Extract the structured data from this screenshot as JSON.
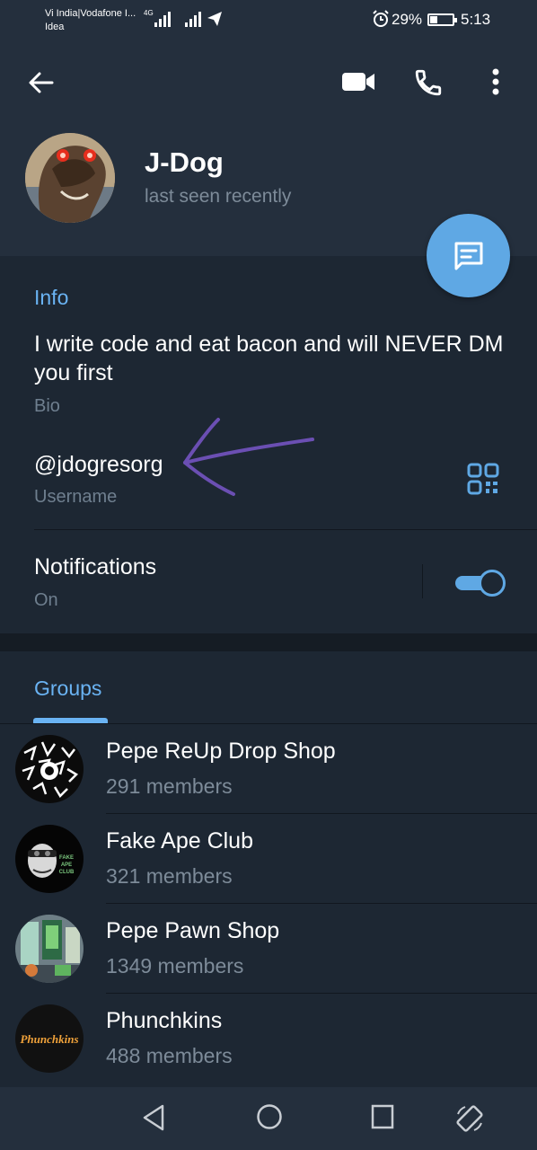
{
  "status_bar": {
    "carrier_line1": "Vi India|Vodafone I...",
    "carrier_line2": "Idea",
    "network_type": "4G",
    "battery_percent": "29%",
    "time": "5:13",
    "icons": [
      "signal-icon",
      "signal-icon",
      "telegram-icon",
      "alarm-icon",
      "battery-icon"
    ]
  },
  "header": {
    "back_icon": "arrow-left-icon",
    "actions": [
      "video-call-icon",
      "phone-icon",
      "more-vert-icon"
    ]
  },
  "profile": {
    "name": "J-Dog",
    "status": "last seen recently",
    "message_button_icon": "message-icon"
  },
  "info": {
    "section_title": "Info",
    "bio": "I write code and eat bacon and will NEVER DM you first",
    "bio_label": "Bio",
    "username": "@jdogresorg",
    "username_label": "Username",
    "qr_icon": "qr-code-icon"
  },
  "notifications": {
    "title": "Notifications",
    "state": "On",
    "enabled": true
  },
  "groups": {
    "tab_label": "Groups",
    "items": [
      {
        "name": "Pepe ReUp Drop Shop",
        "members": "291 members"
      },
      {
        "name": "Fake Ape Club",
        "members": "321 members"
      },
      {
        "name": "Pepe Pawn Shop",
        "members": "1349 members"
      },
      {
        "name": "Phunchkins",
        "members": "488 members"
      }
    ],
    "avatar_text": {
      "fake_ape": "FAKE APE CLUB",
      "phunchkins": "Phunchkins"
    }
  },
  "nav_bar": {
    "buttons": [
      "back-triangle-icon",
      "home-circle-icon",
      "recents-square-icon",
      "rotate-screen-icon"
    ]
  },
  "colors": {
    "accent": "#6ab3f3",
    "fab": "#5fa8e4",
    "background": "#1d2733",
    "header": "#242f3d",
    "annotation_arrow": "#6b4fb3"
  }
}
